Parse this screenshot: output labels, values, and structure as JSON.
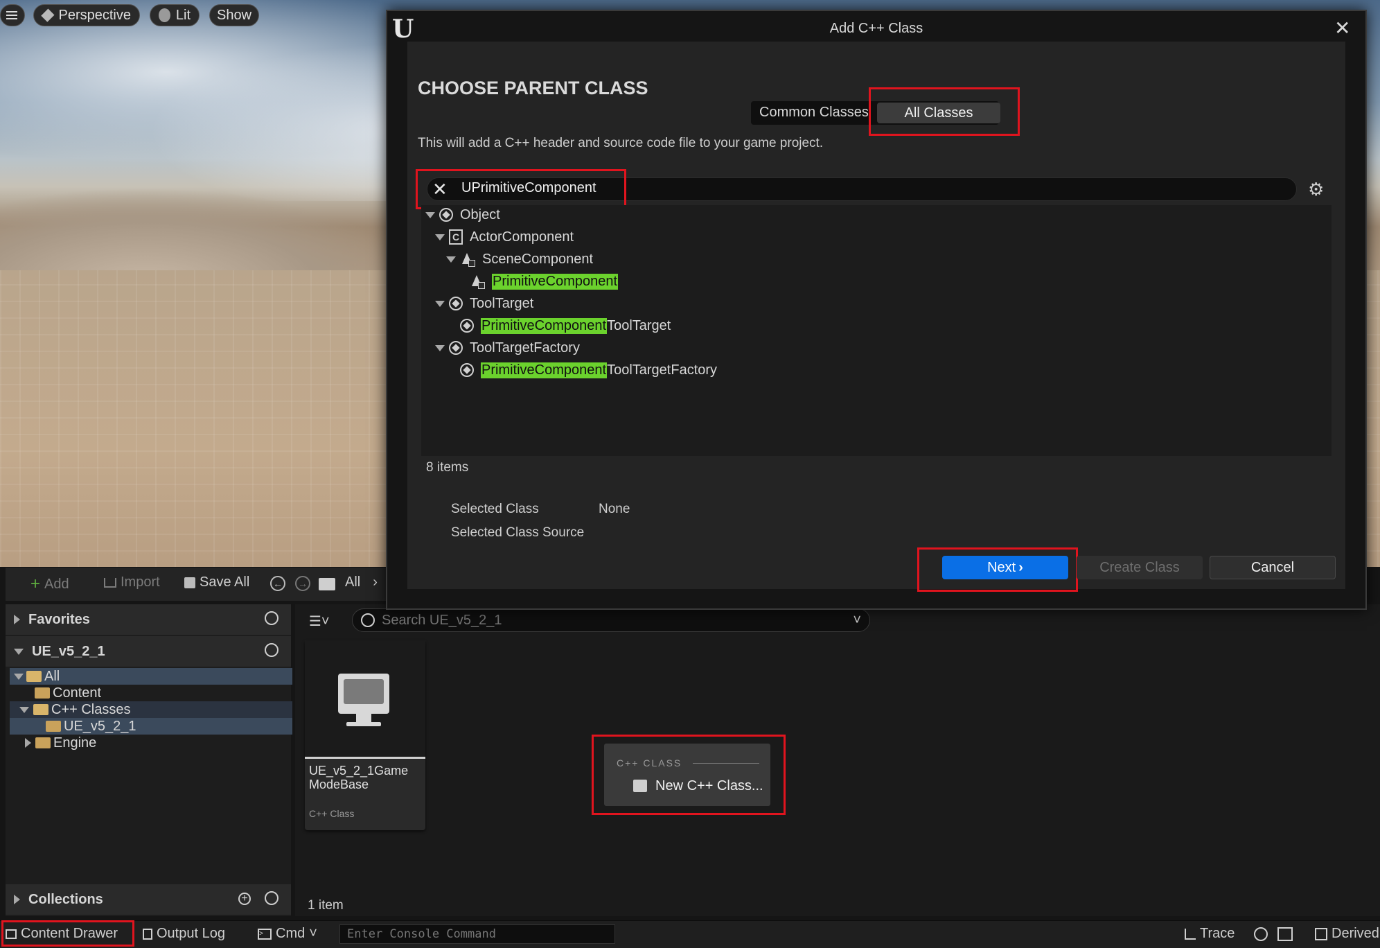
{
  "viewport": {
    "menu_icon": "hamburger-icon",
    "perspective_label": "Perspective",
    "lit_label": "Lit",
    "show_label": "Show"
  },
  "content_browser": {
    "toolbar": {
      "add_label": "Add",
      "import_label": "Import",
      "save_all_label": "Save All",
      "path_label": "All"
    },
    "favorites_label": "Favorites",
    "project_label": "UE_v5_2_1",
    "tree": [
      {
        "label": "All"
      },
      {
        "label": "Content"
      },
      {
        "label": "C++ Classes"
      },
      {
        "label": "UE_v5_2_1"
      },
      {
        "label": "Engine"
      }
    ],
    "collections_label": "Collections",
    "search_placeholder": "Search UE_v5_2_1",
    "asset": {
      "name": "UE_v5_2_1Game ModeBase",
      "type": "C++ Class"
    },
    "new_cpp_section": "C++ CLASS",
    "new_cpp_label": "New C++ Class...",
    "item_count": "1 item"
  },
  "statusbar": {
    "content_drawer": "Content Drawer",
    "output_log": "Output Log",
    "cmd": "Cmd",
    "console_placeholder": "Enter Console Command",
    "trace": "Trace",
    "derived": "Derived"
  },
  "dialog": {
    "title": "Add C++ Class",
    "heading": "CHOOSE PARENT CLASS",
    "tab_common": "Common Classes",
    "tab_all": "All Classes",
    "description": "This will add a C++ header and source code file to your game project.",
    "search_value": "UPrimitiveComponent",
    "tree": {
      "object": "Object",
      "actor_component": "ActorComponent",
      "scene_component": "SceneComponent",
      "primitive_component": "PrimitiveComponent",
      "tool_target": "ToolTarget",
      "ptt_highlight": "PrimitiveComponent",
      "ptt_suffix": "ToolTarget",
      "tool_target_factory": "ToolTargetFactory",
      "pttf_highlight": "PrimitiveComponent",
      "pttf_suffix": "ToolTargetFactory"
    },
    "item_count": "8 items",
    "selected_class_label": "Selected Class",
    "selected_class_value": "None",
    "selected_source_label": "Selected Class Source",
    "next_label": "Next",
    "create_label": "Create Class",
    "cancel_label": "Cancel"
  },
  "colors": {
    "accent_blue": "#0a6fe6",
    "highlight_green": "#6bd22d",
    "annotation_red": "#e0141e"
  }
}
